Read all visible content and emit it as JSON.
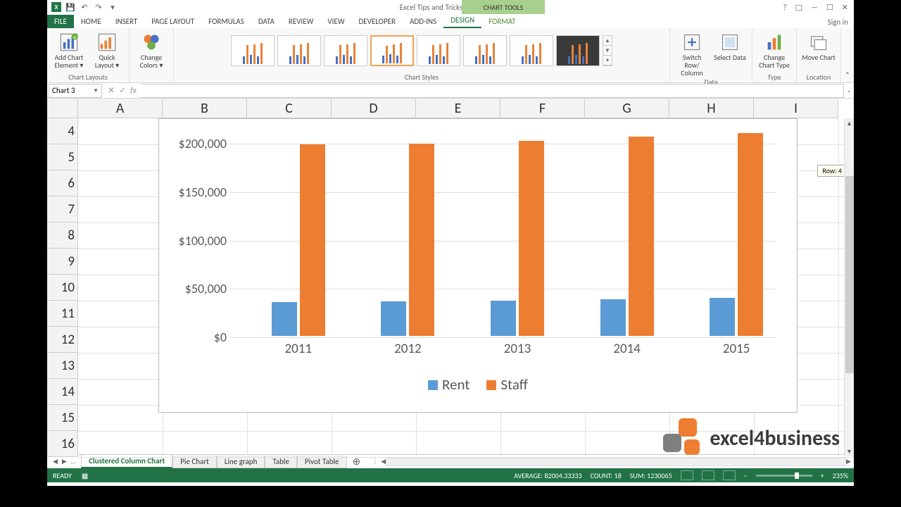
{
  "window": {
    "title": "Excel Tips and Tricks Final - Excel",
    "chart_tools_label": "CHART TOOLS",
    "sign_in": "Sign in"
  },
  "qat": {
    "save": "💾",
    "undo": "↶",
    "redo": "↷"
  },
  "tabs": {
    "file": "FILE",
    "home": "HOME",
    "insert": "INSERT",
    "page_layout": "PAGE LAYOUT",
    "formulas": "FORMULAS",
    "data": "DATA",
    "review": "REVIEW",
    "view": "VIEW",
    "developer": "DEVELOPER",
    "addins": "ADD-INS",
    "design": "DESIGN",
    "format": "FORMAT"
  },
  "ribbon": {
    "add_chart_element": "Add Chart Element ▾",
    "quick_layout": "Quick Layout ▾",
    "change_colors": "Change Colors ▾",
    "switch_row_col": "Switch Row/ Column",
    "select_data": "Select Data",
    "change_chart_type": "Change Chart Type",
    "move_chart": "Move Chart",
    "groups": {
      "chart_layouts": "Chart Layouts",
      "chart_styles": "Chart Styles",
      "data": "Data",
      "type": "Type",
      "location": "Location"
    }
  },
  "namebox": "Chart 3",
  "columns": [
    "A",
    "B",
    "C",
    "D",
    "E",
    "F",
    "G",
    "H",
    "I"
  ],
  "rows": [
    "4",
    "5",
    "6",
    "7",
    "8",
    "9",
    "10",
    "11",
    "12",
    "13",
    "14",
    "15",
    "16"
  ],
  "scroll_tip": "Row: 4",
  "chart_data": {
    "type": "bar",
    "categories": [
      "2011",
      "2012",
      "2013",
      "2014",
      "2015"
    ],
    "series": [
      {
        "name": "Rent",
        "values": [
          35000,
          35500,
          36500,
          38000,
          39000
        ],
        "color": "#5b9bd5"
      },
      {
        "name": "Staff",
        "values": [
          198000,
          199000,
          202000,
          206000,
          210000
        ],
        "color": "#ed7d31"
      }
    ],
    "ylabels": [
      "$0",
      "$50,000",
      "$100,000",
      "$150,000",
      "$200,000"
    ],
    "ylim": [
      0,
      220000
    ],
    "xlabel": "",
    "ylabel": "",
    "title": ""
  },
  "sheet_tabs": {
    "active": "Clustered Column Chart",
    "others": [
      "Pie Chart",
      "Line graph",
      "Table",
      "Pivot Table"
    ]
  },
  "status": {
    "ready": "READY",
    "average": "AVERAGE: 82004.33333",
    "count": "COUNT: 18",
    "sum": "SUM: 1230065",
    "zoom": "235%"
  },
  "watermark": "excel4business"
}
